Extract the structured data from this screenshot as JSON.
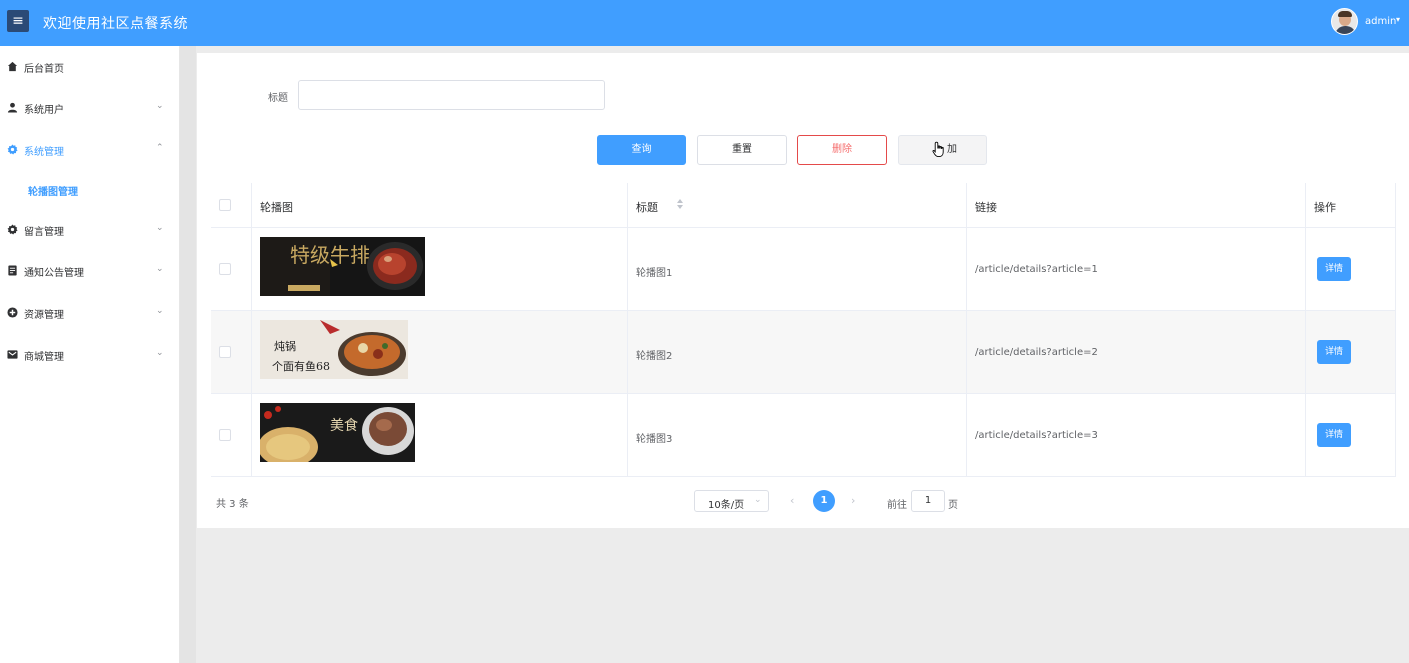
{
  "header": {
    "title": "欢迎使用社区点餐系统",
    "menu_icon": "hamburger-icon",
    "user_name": "admin",
    "brand_color": "#409eff"
  },
  "sidebar": {
    "items": [
      {
        "label": "后台首页",
        "icon": "home-icon"
      },
      {
        "label": "系统用户",
        "icon": "user-icon"
      },
      {
        "label": "系统管理",
        "icon": "gear-icon",
        "expanded": true
      },
      {
        "label": "留言管理",
        "icon": "gear-icon"
      },
      {
        "label": "通知公告管理",
        "icon": "document-icon"
      },
      {
        "label": "资源管理",
        "icon": "plus-circle-icon"
      },
      {
        "label": "商城管理",
        "icon": "mail-icon"
      }
    ],
    "sub_item": {
      "label": "轮播图管理"
    }
  },
  "filter": {
    "title_label": "标题",
    "title_value": ""
  },
  "actions": {
    "query": "查询",
    "reset": "重置",
    "delete": "删除",
    "add": "加"
  },
  "table": {
    "headers": {
      "image": "轮播图",
      "title": "标题",
      "link": "链接",
      "ops": "操作"
    },
    "rows": [
      {
        "title": "轮播图1",
        "link": "/article/details?article=1",
        "action": "详情",
        "image_text": "特级牛排"
      },
      {
        "title": "轮播图2",
        "link": "/article/details?article=2",
        "action": "详情",
        "image_text": "个面有鱼68"
      },
      {
        "title": "轮播图3",
        "link": "/article/details?article=3",
        "action": "详情",
        "image_text": "美食"
      }
    ]
  },
  "pagination": {
    "total": "共 3 条",
    "page_size": "10条/页",
    "current_page": "1",
    "goto_label": "前往",
    "goto_value": "1",
    "goto_suffix": "页"
  }
}
